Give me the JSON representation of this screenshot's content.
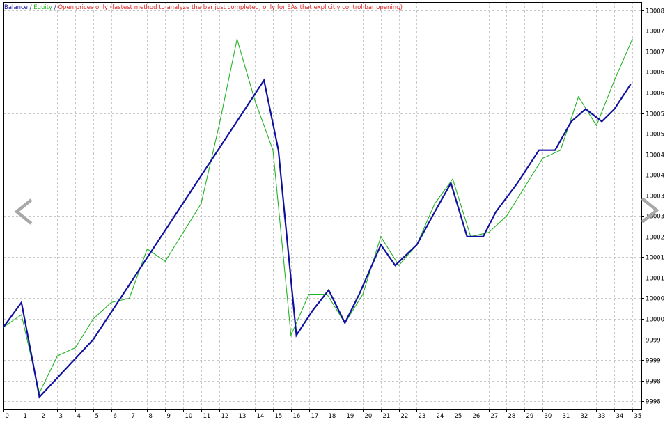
{
  "legend": {
    "balance": "Balance",
    "sep1": " / ",
    "equity": "Equity",
    "sep2": " / ",
    "mode": "Open prices only (fastest method to analyze the bar just completed, only for EAs that explicitly control bar opening)"
  },
  "colors": {
    "balance": "#1010a0",
    "equity": "#22b422",
    "mode": "#e02020",
    "axis": "#000000",
    "grid": "#c8c8c8",
    "arrow": "#a8a8a8"
  },
  "icons": {
    "prev": "chevron-left-icon",
    "next": "chevron-right-icon"
  },
  "chart_data": {
    "type": "line",
    "y_tick_labels": [
      "10008",
      "10007",
      "10007",
      "10006",
      "10006",
      "10005",
      "10005",
      "10004",
      "10004",
      "10003",
      "10003",
      "10002",
      "10001",
      "10001",
      "10000",
      "10000",
      "9999",
      "9999",
      "9998",
      "9998"
    ],
    "y_tick_values": [
      10008.0,
      10007.5,
      10007.0,
      10006.5,
      10006.0,
      10005.5,
      10005.0,
      10004.5,
      10004.0,
      10003.5,
      10003.0,
      10002.5,
      10002.0,
      10001.5,
      10001.0,
      10000.5,
      10000.0,
      9999.5,
      9999.0,
      9998.5
    ],
    "ylim": [
      9998.3,
      10008.2
    ],
    "x_tick_labels": [
      "0",
      "1",
      "2",
      "3",
      "4",
      "5",
      "6",
      "7",
      "8",
      "9",
      "10",
      "11",
      "12",
      "13",
      "14",
      "15",
      "16",
      "17",
      "18",
      "19",
      "20",
      "21",
      "22",
      "23",
      "24",
      "25",
      "26",
      "27",
      "28",
      "29",
      "30",
      "31",
      "32",
      "33",
      "34",
      "35"
    ],
    "xlim": [
      0,
      35.5
    ],
    "grid": true,
    "series": [
      {
        "name": "Balance",
        "x": [
          0,
          1,
          2,
          5,
          14.5,
          15.3,
          16.3,
          17.2,
          18.1,
          19,
          19.8,
          21,
          21.8,
          23,
          24,
          24.9,
          25.8,
          26.7,
          27.4,
          28.6,
          29.8,
          30.7,
          31.6,
          32.4,
          33.3,
          34,
          34.9
        ],
        "y": [
          10000.3,
          10000.9,
          9998.6,
          10000.0,
          10006.3,
          10004.6,
          10000.1,
          10000.7,
          10001.2,
          10000.4,
          10001.1,
          10002.3,
          10001.8,
          10002.3,
          10003.1,
          10003.8,
          10002.5,
          10002.5,
          10003.1,
          10003.8,
          10004.6,
          10004.6,
          10005.3,
          10005.6,
          10005.3,
          10005.6,
          10006.2
        ]
      },
      {
        "name": "Equity",
        "x": [
          0,
          1,
          2,
          3,
          4,
          5,
          6,
          7,
          8,
          9,
          10,
          11,
          12,
          13,
          14,
          15,
          16,
          17,
          18,
          19,
          20,
          21,
          22,
          23,
          24,
          25,
          26,
          27,
          28,
          29,
          30,
          31,
          32,
          33,
          34,
          35
        ],
        "y": [
          10000.3,
          10000.6,
          9998.7,
          9999.6,
          9999.8,
          10000.5,
          10000.9,
          10001.0,
          10002.2,
          10001.9,
          10002.6,
          10003.3,
          10005.2,
          10007.3,
          10005.8,
          10004.6,
          10000.1,
          10001.1,
          10001.1,
          10000.4,
          10001.1,
          10002.5,
          10001.8,
          10002.3,
          10003.3,
          10003.9,
          10002.5,
          10002.6,
          10003.0,
          10003.7,
          10004.4,
          10004.6,
          10005.9,
          10005.2,
          10006.3,
          10007.3
        ]
      }
    ]
  }
}
